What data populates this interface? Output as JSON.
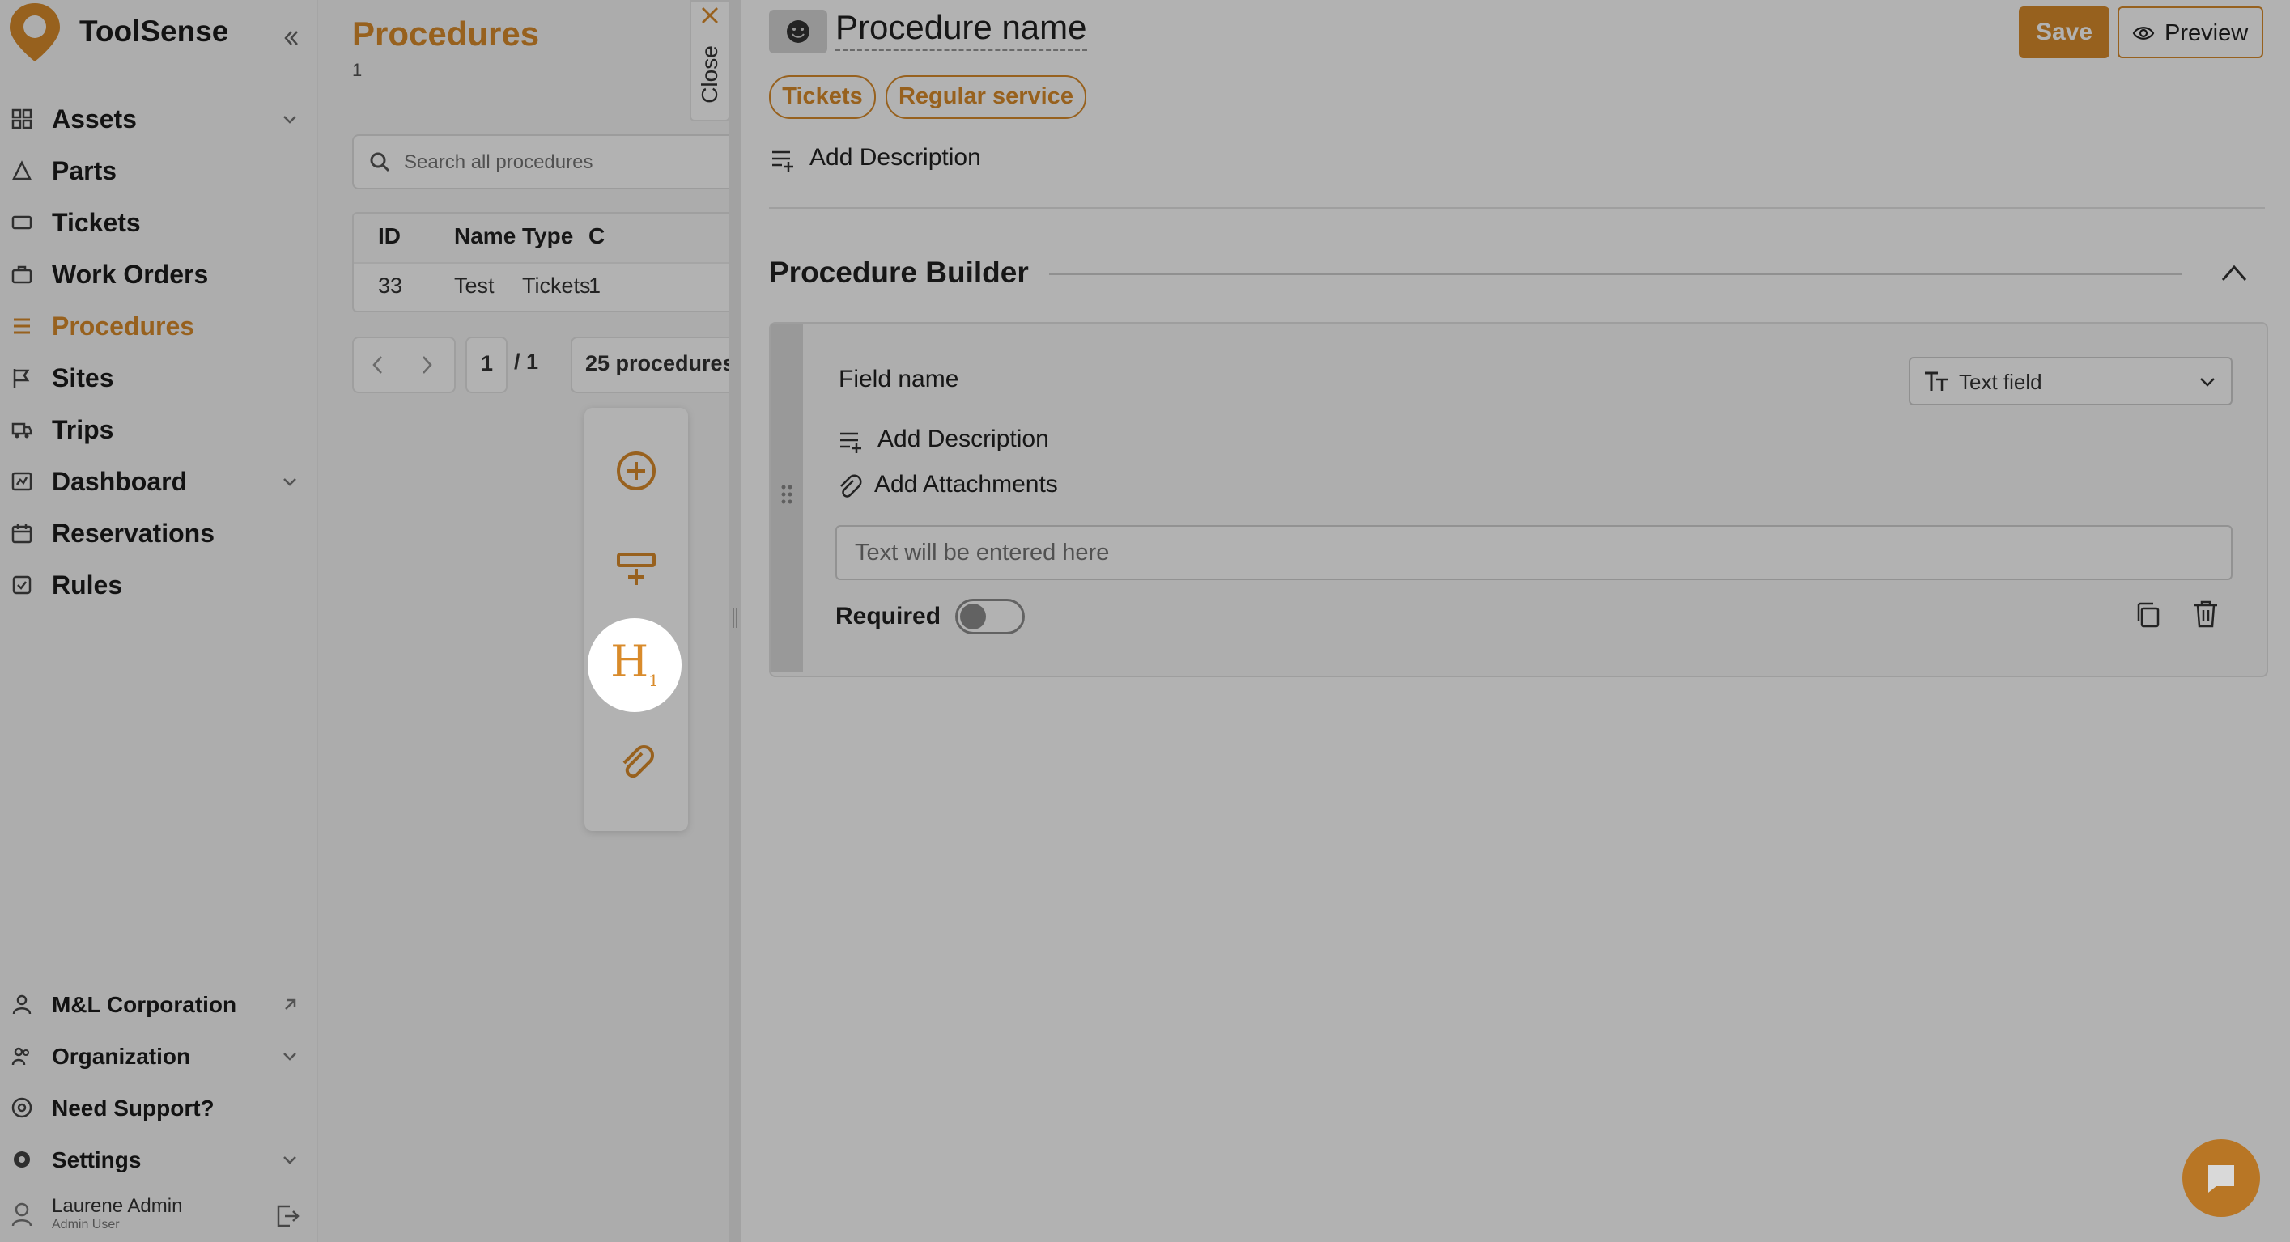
{
  "brand": {
    "name": "ToolSense"
  },
  "sidebar": {
    "items": [
      {
        "label": "Assets",
        "icon": "grid-icon",
        "has_chevron": true
      },
      {
        "label": "Parts",
        "icon": "parts-icon",
        "has_chevron": false
      },
      {
        "label": "Tickets",
        "icon": "ticket-icon",
        "has_chevron": false
      },
      {
        "label": "Work Orders",
        "icon": "briefcase-icon",
        "has_chevron": false
      },
      {
        "label": "Procedures",
        "icon": "list-icon",
        "has_chevron": false,
        "active": true
      },
      {
        "label": "Sites",
        "icon": "flag-icon",
        "has_chevron": false
      },
      {
        "label": "Trips",
        "icon": "truck-icon",
        "has_chevron": false
      },
      {
        "label": "Dashboard",
        "icon": "dashboard-icon",
        "has_chevron": true
      },
      {
        "label": "Reservations",
        "icon": "calendar-icon",
        "has_chevron": false
      },
      {
        "label": "Rules",
        "icon": "rules-icon",
        "has_chevron": false
      }
    ],
    "bottom_items": [
      {
        "label": "M&L Corporation",
        "icon": "person-icon",
        "trailing": "external-link-icon"
      },
      {
        "label": "Organization",
        "icon": "people-icon",
        "trailing": "chevron-down-icon"
      },
      {
        "label": "Need Support?",
        "icon": "help-icon",
        "trailing": ""
      },
      {
        "label": "Settings",
        "icon": "gear-icon",
        "trailing": "chevron-down-icon"
      }
    ],
    "user": {
      "name": "Laurene Admin",
      "role": "Admin User"
    }
  },
  "list_panel": {
    "title": "Procedures",
    "count": "1",
    "search_placeholder": "Search all procedures",
    "columns": [
      "ID",
      "Name",
      "Type",
      "C"
    ],
    "rows": [
      {
        "id": "33",
        "name": "Test",
        "type": "Tickets",
        "c": "1"
      }
    ],
    "pager": {
      "page": "1",
      "total": "/ 1",
      "page_size": "25 procedures"
    }
  },
  "close_tab": {
    "label": "Close"
  },
  "tool_bar": {
    "tools": [
      {
        "name": "add-field-icon"
      },
      {
        "name": "add-section-icon"
      },
      {
        "name": "heading-icon",
        "glyph": "H",
        "sub": "1"
      },
      {
        "name": "attachment-icon"
      }
    ]
  },
  "editor": {
    "procedure_name": "Procedure name",
    "save_label": "Save",
    "preview_label": "Preview",
    "tags": [
      "Tickets",
      "Regular service"
    ],
    "add_description": "Add Description",
    "builder_title": "Procedure Builder",
    "field": {
      "name_label": "Field name",
      "type_label": "Text field",
      "add_description": "Add Description",
      "add_attachments": "Add Attachments",
      "input_placeholder": "Text will be entered here",
      "required_label": "Required",
      "required": false
    }
  },
  "colors": {
    "accent": "#d98b2b",
    "overlay": "rgba(0,0,0,0.30)"
  }
}
